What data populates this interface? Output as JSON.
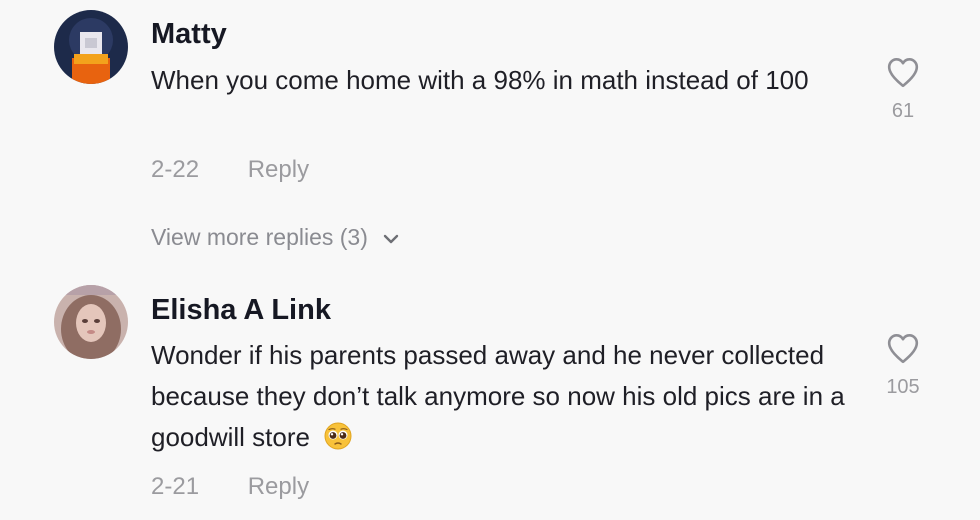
{
  "comments": [
    {
      "username": "Matty",
      "text": "When you come home with a 98% in math instead of 100",
      "date": "2-22",
      "reply_label": "Reply",
      "like_count": "61",
      "like_icon": "heart-outline-icon"
    },
    {
      "username": "Elisha A Link",
      "text": "Wonder if his parents passed away and he never collected because they don’t talk anymore so now his old pics are in a goodwill store",
      "emoji": "pleading-face-emoji",
      "date": "2-21",
      "reply_label": "Reply",
      "like_count": "105",
      "like_icon": "heart-outline-icon"
    }
  ],
  "view_more_replies": {
    "label": "View more replies (3)",
    "icon": "chevron-down-icon"
  },
  "colors": {
    "background": "#f8f8f8",
    "username": "#161823",
    "text": "#1f1f26",
    "muted": "#9b9b9f"
  }
}
